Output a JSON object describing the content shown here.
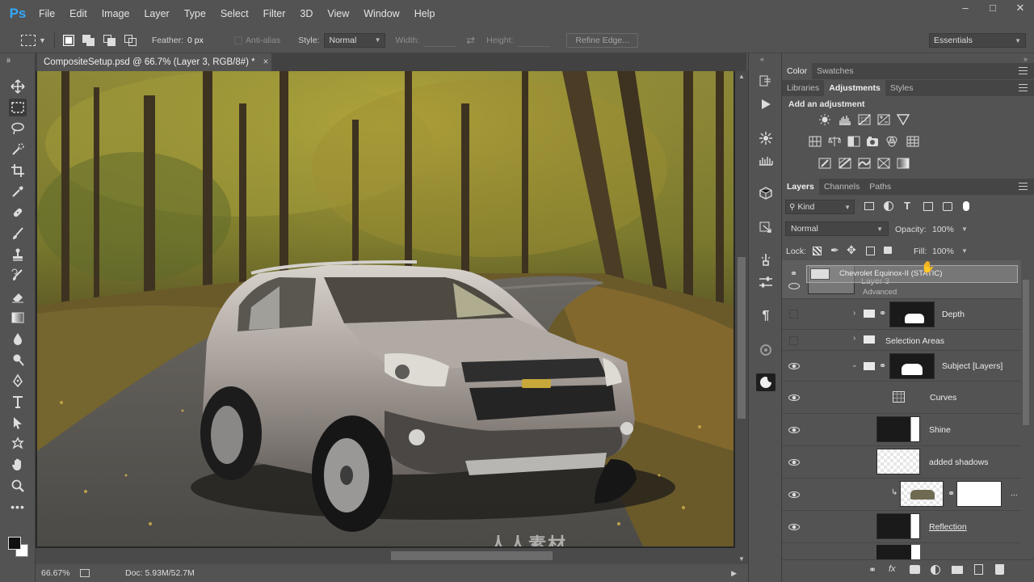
{
  "app": {
    "logo": "Ps"
  },
  "menu": [
    "File",
    "Edit",
    "Image",
    "Layer",
    "Type",
    "Select",
    "Filter",
    "3D",
    "View",
    "Window",
    "Help"
  ],
  "options": {
    "feather_label": "Feather:",
    "feather_value": "0 px",
    "antialias_label": "Anti-alias",
    "style_label": "Style:",
    "style_value": "Normal",
    "width_label": "Width:",
    "height_label": "Height:",
    "refine_edge": "Refine Edge...",
    "workspace": "Essentials"
  },
  "document": {
    "tab_title": "CompositeSetup.psd @ 66.7% (Layer 3, RGB/8#) *",
    "close": "×"
  },
  "status": {
    "zoom": "66.67%",
    "doc": "Doc: 5.93M/52.7M"
  },
  "color_panel": {
    "tabs": [
      "Color",
      "Swatches"
    ]
  },
  "adjust_panel": {
    "tabs": [
      "Libraries",
      "Adjustments",
      "Styles"
    ],
    "active": "Adjustments",
    "title": "Add an adjustment"
  },
  "layers_panel": {
    "tabs": [
      "Layers",
      "Channels",
      "Paths"
    ],
    "filter": "Kind",
    "blend_mode": "Normal",
    "opacity_label": "Opacity:",
    "opacity": "100%",
    "lock_label": "Lock:",
    "fill_label": "Fill:",
    "fill": "100%",
    "drag_ghost": "Chevrolet Equinox-II (STATIC)",
    "layers": [
      {
        "name": "Layer 3",
        "sub": "Advanced",
        "visible": true
      },
      {
        "name": "Depth",
        "type": "group",
        "visible": false
      },
      {
        "name": "Selection Areas",
        "type": "group",
        "visible": false
      },
      {
        "name": "Subject [Layers]",
        "type": "group",
        "visible": true
      },
      {
        "name": "Curves",
        "type": "adjustment",
        "visible": true
      },
      {
        "name": "Shine",
        "visible": true
      },
      {
        "name": "added shadows",
        "visible": true
      },
      {
        "name": "...",
        "visible": true
      },
      {
        "name": "Reflection",
        "visible": true
      }
    ]
  },
  "watermark": "人人素材",
  "colors": {
    "accent": "#31a8ff",
    "panel": "#535353",
    "dark": "#454545"
  }
}
